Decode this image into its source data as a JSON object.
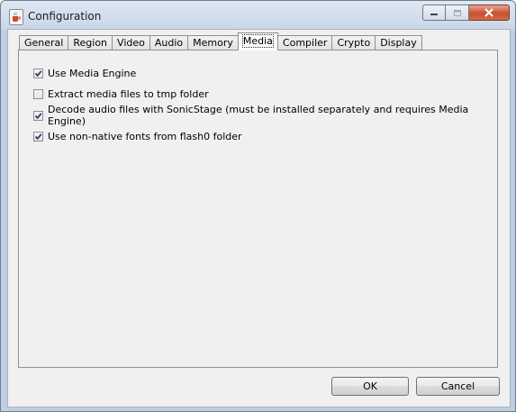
{
  "window": {
    "title": "Configuration",
    "icons": {
      "app": "java-cup-icon",
      "minimize": "minimize-icon",
      "maximize": "maximize-icon",
      "close": "close-icon"
    }
  },
  "tabs": [
    {
      "label": "General",
      "active": false
    },
    {
      "label": "Region",
      "active": false
    },
    {
      "label": "Video",
      "active": false
    },
    {
      "label": "Audio",
      "active": false
    },
    {
      "label": "Memory",
      "active": false
    },
    {
      "label": "Media",
      "active": true
    },
    {
      "label": "Compiler",
      "active": false
    },
    {
      "label": "Crypto",
      "active": false
    },
    {
      "label": "Display",
      "active": false
    }
  ],
  "options": [
    {
      "label": "Use Media Engine",
      "checked": true
    },
    {
      "label": "Extract media files to tmp folder",
      "checked": false
    },
    {
      "label": "Decode audio files with SonicStage (must be installed separately and requires Media Engine)",
      "checked": true
    },
    {
      "label": "Use non-native fonts from flash0 folder",
      "checked": true
    }
  ],
  "buttons": {
    "ok": "OK",
    "cancel": "Cancel"
  },
  "colors": {
    "close_button": "#c7502f",
    "title_bar": "#c9d7e8",
    "checkmark": "#2d3a66"
  }
}
